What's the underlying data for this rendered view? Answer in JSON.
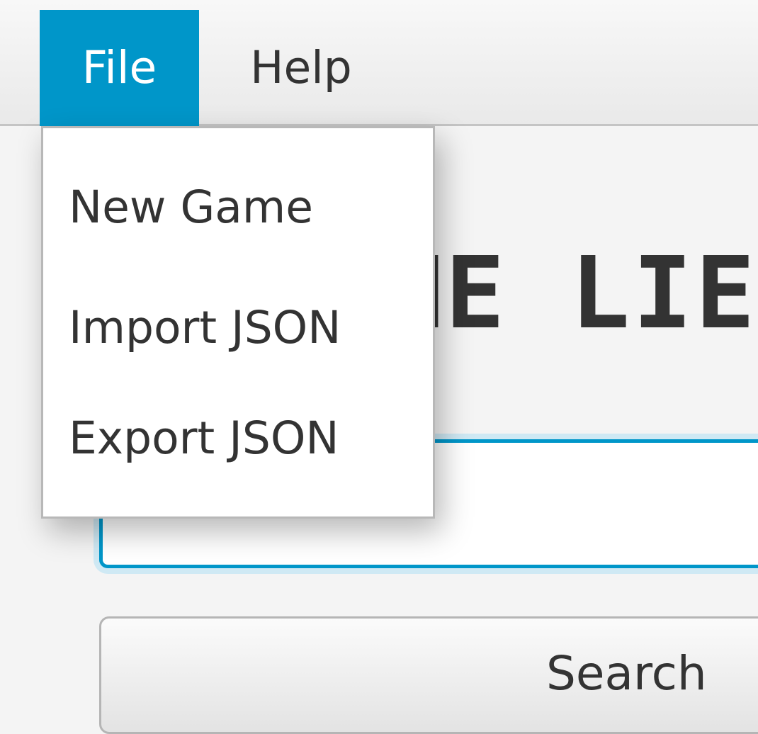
{
  "menubar": {
    "file_label": "File",
    "help_label": "Help"
  },
  "file_menu": {
    "items": [
      "New Game",
      "Import JSON",
      "Export JSON"
    ]
  },
  "main": {
    "heading_visible": "ME LIE",
    "search_input_value": "",
    "search_button_label": "Search"
  },
  "colors": {
    "accent": "#0096c9",
    "text": "#333333",
    "background": "#f4f4f4"
  }
}
